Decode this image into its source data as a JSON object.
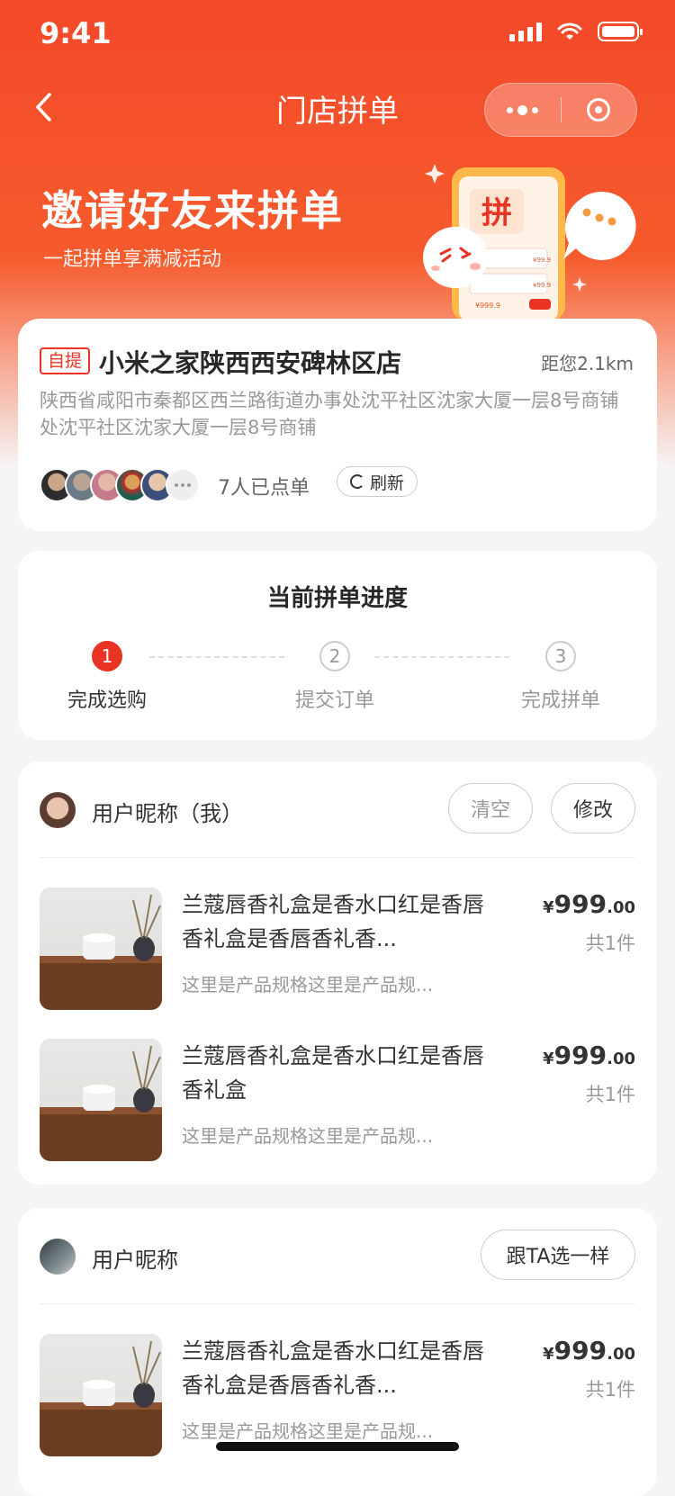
{
  "status_bar": {
    "time": "9:41"
  },
  "nav": {
    "title": "门店拼单"
  },
  "hero": {
    "title": "邀请好友来拼单",
    "subtitle": "一起拼单享满减活动",
    "badge_char": "拼",
    "price_tag": "¥999.9",
    "mini_price": "¥99.9"
  },
  "store": {
    "tag": "自提",
    "name": "小米之家陕西西安碑林区店",
    "distance": "距您2.1km",
    "address": "陕西省咸阳市秦都区西兰路街道办事处沈平社区沈家大厦一层8号商铺处沈平社区沈家大厦一层8号商铺",
    "ordered_count": "7人已点单",
    "refresh_label": "刷新"
  },
  "progress": {
    "title": "当前拼单进度",
    "steps": [
      {
        "num": "1",
        "label": "完成选购"
      },
      {
        "num": "2",
        "label": "提交订单"
      },
      {
        "num": "3",
        "label": "完成拼单"
      }
    ]
  },
  "orders": [
    {
      "user_name": "用户昵称（我）",
      "clear_label": "清空",
      "edit_label": "修改",
      "items": [
        {
          "title": "兰蔻唇香礼盒是香水口红是香唇香礼盒是香唇香礼香...",
          "spec": "这里是产品规格这里是产品规...",
          "currency": "¥",
          "price_int": "999",
          "price_dec": ".00",
          "qty": "共1件"
        },
        {
          "title": "兰蔻唇香礼盒是香水口红是香唇香礼盒",
          "spec": "这里是产品规格这里是产品规...",
          "currency": "¥",
          "price_int": "999",
          "price_dec": ".00",
          "qty": "共1件"
        }
      ]
    },
    {
      "user_name": "用户昵称",
      "follow_label": "跟TA选一样",
      "items": [
        {
          "title": "兰蔻唇香礼盒是香水口红是香唇香礼盒是香唇香礼香...",
          "spec": "这里是产品规格这里是产品规...",
          "currency": "¥",
          "price_int": "999",
          "price_dec": ".00",
          "qty": "共1件"
        }
      ]
    }
  ],
  "colors": {
    "brand": "#e93323",
    "hero": "#f3492a",
    "bg": "#f5f5f5"
  }
}
